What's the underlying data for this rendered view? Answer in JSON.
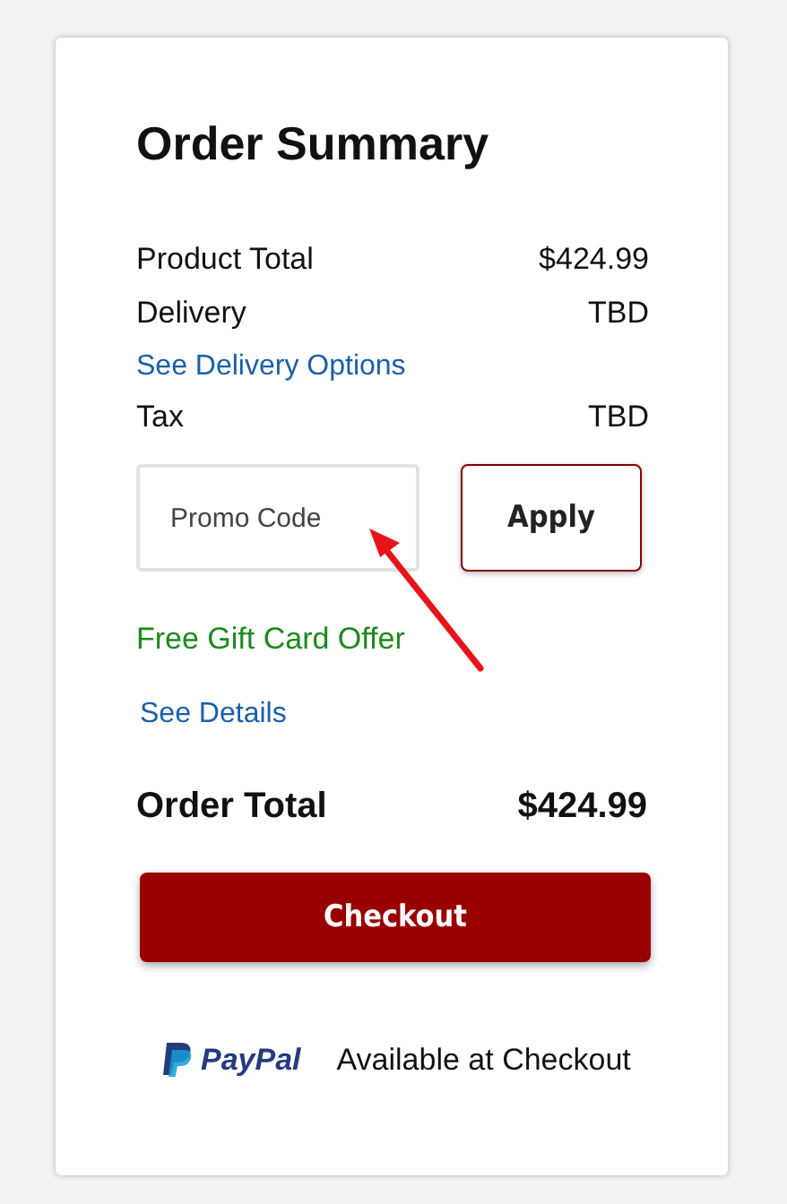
{
  "title": "Order Summary",
  "lines": [
    {
      "kind": "row",
      "label": "Product Total",
      "value": "$424.99"
    },
    {
      "kind": "row",
      "label": "Delivery",
      "value": "TBD"
    },
    {
      "kind": "link",
      "label": "See Delivery Options"
    },
    {
      "kind": "row",
      "label": "Tax",
      "value": "TBD"
    }
  ],
  "promo": {
    "placeholder": "Promo Code",
    "button": "Apply"
  },
  "offer": {
    "title": "Free Gift Card Offer",
    "link": "See Details"
  },
  "total": {
    "label": "Order Total",
    "value": "$424.99"
  },
  "checkout": "Checkout",
  "paypal": {
    "logo": "PayPal",
    "note": "Available at Checkout"
  }
}
